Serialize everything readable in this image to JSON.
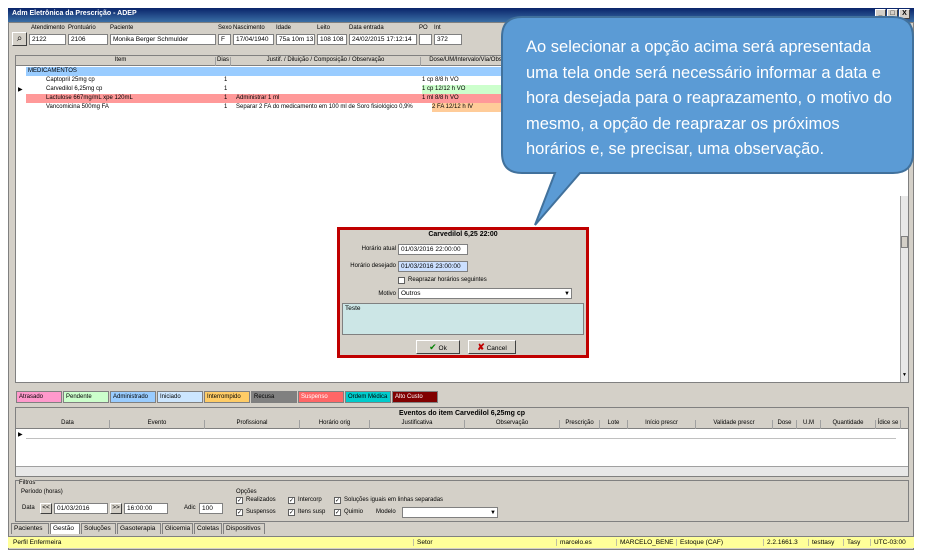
{
  "window": {
    "title": "Adm Eletrônica da Prescrição - ADEP",
    "min": "_",
    "max": "□",
    "close": "X"
  },
  "patient": {
    "labels": {
      "atendimento": "Atendimento",
      "prontuario": "Prontuário",
      "paciente": "Paciente",
      "sexo": "Sexo",
      "nascimento": "Nascimento",
      "idade": "Idade",
      "leito": "Leito",
      "data_entrada": "Data entrada",
      "pf": "PO",
      "int": "Int"
    },
    "atendimento": "2122",
    "prontuario": "2106",
    "paciente": "Monika Berger Schmulder",
    "sexo": "F",
    "nascimento": "17/04/1940",
    "idade": "75a 10m 13",
    "leito": "108 108",
    "data_entrada": "24/02/2015 17:12:14",
    "pf": "",
    "int": "372"
  },
  "grid": {
    "columns": [
      "Item",
      "Dias",
      "Justif. / Diluição / Composição / Observação",
      "Dose/UM/Intervalo/Via/Obs"
    ],
    "group": "MEDICAMENTOS",
    "rows": [
      {
        "item": "Captopril 25mg cp",
        "dias": "1",
        "obs": "",
        "dose": "1 cp   8/8 h   VO"
      },
      {
        "item": "Carvedilol 6,25mg cp",
        "dias": "1",
        "obs": "",
        "dose": "1 cp   12/12 h   VO"
      },
      {
        "item": "Lactulose 667mg/mL xpe 120mL",
        "dias": "1",
        "obs": "Administrar 1 ml",
        "dose": "1 ml   8/8 h   VO"
      },
      {
        "item": "Vancomicina 500mg FA",
        "dias": "1",
        "obs": "Separar 2 FA do medicamento em 100 ml de Soro fisiológico 0,9%",
        "dose": "2 FA   12/12 h   IV"
      }
    ]
  },
  "callout": {
    "text": "Ao selecionar a opção acima será apresentada uma tela onde será necessário informar a data e hora desejada para o reaprazamento, o motivo do mesmo, a opção de reaprazar os próximos horários e, se precisar, uma observação."
  },
  "dialog": {
    "title": "Carvedilol 6,25   22:00",
    "horario_atual_label": "Horário atual",
    "horario_atual": "01/03/2016 22:00:00",
    "horario_desejado_label": "Horário desejado",
    "horario_desejado": "01/03/2016 23:00:00",
    "reaprazar_label": "Reaprazar horários seguintes",
    "motivo_label": "Motivo",
    "motivo_value": "Outros",
    "observacao": "Teste",
    "ok_label": "Ok",
    "cancel_label": "Cancel"
  },
  "legend": [
    {
      "label": "Atrasado",
      "color": "#ff99cc",
      "text": "#000000"
    },
    {
      "label": "Pendente",
      "color": "#ccffcc",
      "text": "#000000"
    },
    {
      "label": "Administrado",
      "color": "#99ccff",
      "text": "#000000"
    },
    {
      "label": "Iniciado",
      "color": "#cce6ff",
      "text": "#000000"
    },
    {
      "label": "Interrompido",
      "color": "#ffcc66",
      "text": "#000000"
    },
    {
      "label": "Recusa",
      "color": "#808080",
      "text": "#000000"
    },
    {
      "label": "Suspenso",
      "color": "#ff6666",
      "text": "#ffffff"
    },
    {
      "label": "Ordem Médica",
      "color": "#00cccc",
      "text": "#000000"
    },
    {
      "label": "Alto Custo",
      "color": "#800000",
      "text": "#ffffff"
    }
  ],
  "events": {
    "title": "Eventos do item Carvedilol 6,25mg cp",
    "columns": [
      "Data",
      "Evento",
      "Profissional",
      "Horário orig",
      "Justificativa",
      "Observação",
      "Prescrição",
      "Lote",
      "Início prescr",
      "Validade prescr",
      "Dose",
      "U.M",
      "Quantidade",
      "Ídice se"
    ]
  },
  "filters": {
    "title": "Filtros",
    "periodo_label": "Período (horas)",
    "data_label": "Data",
    "data_value": "01/03/2016",
    "hora_value": "16:00:00",
    "adic_label": "Adic",
    "adic_value": "100",
    "opcoes_label": "Opções",
    "options": [
      {
        "label": "Realizados",
        "checked": true
      },
      {
        "label": "Intercorp",
        "checked": true
      },
      {
        "label": "Soluções iguais em linhas separadas",
        "checked": true
      },
      {
        "label": "Suspensos",
        "checked": true
      },
      {
        "label": "Itens susp",
        "checked": true
      },
      {
        "label": "Quimio",
        "checked": true
      }
    ],
    "modelo_label": "Modelo"
  },
  "tabs": [
    "Pacientes",
    "Gestão",
    "Soluções",
    "Gasoterapia",
    "Glicemia",
    "Coletas",
    "Dispositivos"
  ],
  "statusbar": [
    "Perfil Enfermeira",
    "Setor",
    "marcelo.es",
    "MARCELO_BENE",
    "Estoque (CAF)",
    "2.2.1661.3",
    "testtasy",
    "Tasy",
    "UTC-03:00"
  ]
}
